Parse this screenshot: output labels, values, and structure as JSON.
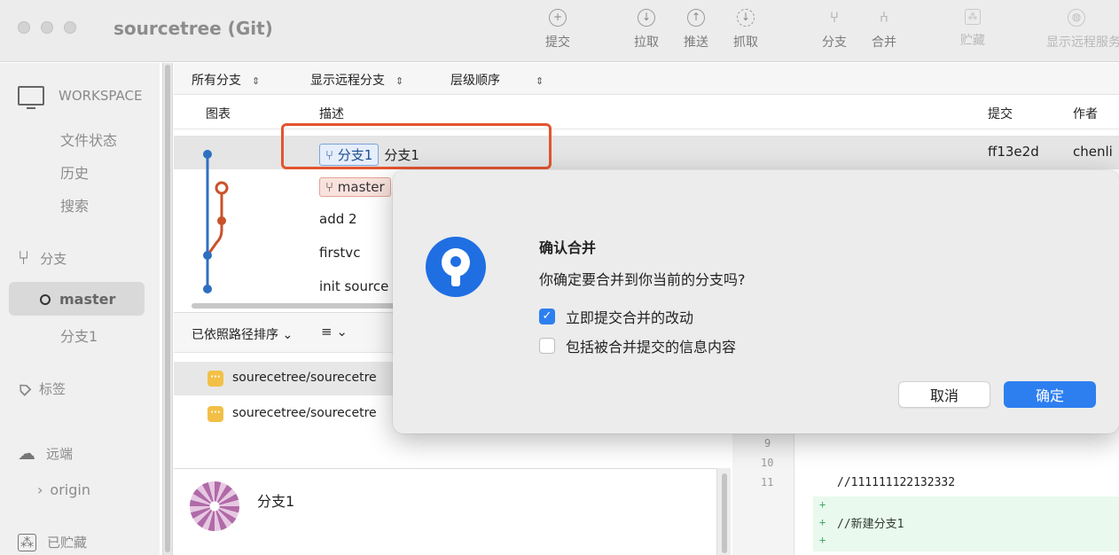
{
  "window": {
    "title": "sourcetree (Git)"
  },
  "toolbar": {
    "commit": "提交",
    "pull": "拉取",
    "push": "推送",
    "fetch": "抓取",
    "branch": "分支",
    "merge": "合并",
    "stash": "贮藏",
    "show_remote": "显示远程服务器"
  },
  "sidebar": {
    "workspace": "WORKSPACE",
    "file_status": "文件状态",
    "history": "历史",
    "search": "搜索",
    "branches": "分支",
    "master": "master",
    "branch1": "分支1",
    "tags": "标签",
    "remotes": "远端",
    "origin": "origin",
    "stashes": "已贮藏"
  },
  "filters": {
    "all_branches": "所有分支",
    "show_remote_branches": "显示远程分支",
    "order": "层级顺序"
  },
  "columns": {
    "graph": "图表",
    "description": "描述",
    "commit": "提交",
    "author": "作者"
  },
  "commits": [
    {
      "branch_tag": "分支1",
      "message": "分支1",
      "hash": "ff13e2d",
      "author": "chenli"
    },
    {
      "branch_tag": "master",
      "message": ""
    },
    {
      "message": "add 2"
    },
    {
      "message": "firstvc"
    },
    {
      "message": "init source"
    }
  ],
  "files_bar": {
    "sort_label": "已依照路径排序",
    "list_icon": "≡"
  },
  "files": [
    {
      "name": "sourecetree/sourecetre"
    },
    {
      "name": "sourecetree/sourecetre"
    }
  ],
  "commit_detail": {
    "message": "分支1"
  },
  "diff": {
    "line_numbers": [
      "9",
      "10",
      "11"
    ],
    "line_11": "//111111122132332",
    "added_line": "//新建分支1"
  },
  "dialog": {
    "title": "确认合并",
    "message": "你确定要合并到你当前的分支吗?",
    "option1": "立即提交合并的改动",
    "option1_checked": true,
    "option2": "包括被合并提交的信息内容",
    "option2_checked": false,
    "cancel": "取消",
    "ok": "确定"
  },
  "colors": {
    "accent": "#2d7ff0",
    "annotation": "#e4542f",
    "master_line": "#c9522b",
    "branch_line": "#2f6fc2"
  }
}
